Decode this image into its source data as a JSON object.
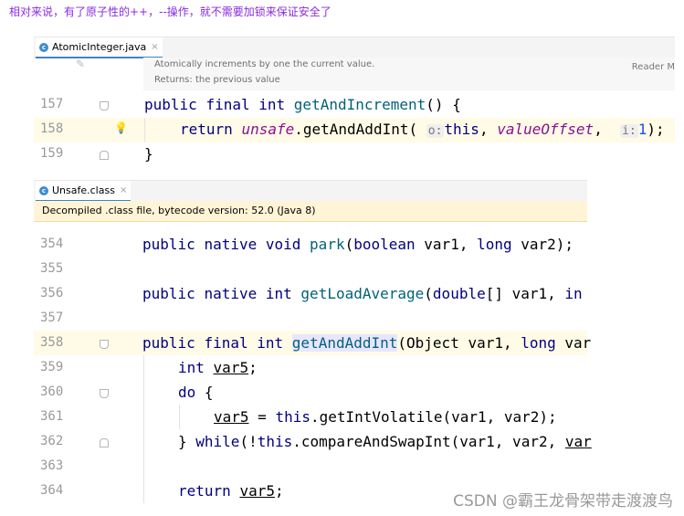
{
  "caption": "相对来说，有了原子性的++，--操作，就不需要加锁来保证安全了",
  "editor1": {
    "tab": {
      "label": "AtomicInteger.java",
      "icon": "java-class-icon",
      "close": "×"
    },
    "doc": {
      "line1": "Atomically increments by one the current value.",
      "line2": "Returns: the previous value",
      "reader": "Reader M"
    },
    "lines": [
      {
        "num": "157"
      },
      {
        "num": "158"
      },
      {
        "num": "159"
      }
    ],
    "code": {
      "l157": {
        "kw1": "public",
        "kw2": "final",
        "kw3": "int",
        "name": "getAndIncrement",
        "rest": "() {"
      },
      "l158": {
        "kw": "return",
        "field": "unsafe",
        "dot": ".",
        "method": "getAndAddInt(",
        "hint1": "o:",
        "this": "this",
        "comma1": ",",
        "field2": "valueOffset",
        "comma2": ",",
        "hint2": "i:",
        "num": "1",
        "end": ");"
      },
      "l159": {
        "brace": "}"
      }
    }
  },
  "editor2": {
    "tab": {
      "label": "Unsafe.class",
      "icon": "class-icon",
      "close": "×"
    },
    "notice": "Decompiled .class file, bytecode version: 52.0 (Java 8)",
    "lines": [
      "354",
      "355",
      "356",
      "357",
      "358",
      "359",
      "360",
      "361",
      "362",
      "363",
      "364"
    ],
    "code": {
      "l354": {
        "kw1": "public",
        "kw2": "native",
        "kw3": "void",
        "name": "park",
        "p1": "(",
        "t1": "boolean",
        "v1": " var1, ",
        "t2": "long",
        "v2": " var2);"
      },
      "l356": {
        "kw1": "public",
        "kw2": "native",
        "kw3": "int",
        "name": "getLoadAverage",
        "p1": "(",
        "t1": "double",
        "v1": "[] var1, ",
        "t2": "in"
      },
      "l358": {
        "kw1": "public",
        "kw2": "final",
        "kw3": "int",
        "name": "getAndAddInt",
        "p1": "(Object var1, ",
        "t2": "long",
        "v2": " var"
      },
      "l359": {
        "kw": "int",
        "var": "var5",
        "end": ";"
      },
      "l360": {
        "kw": "do",
        "end": " {"
      },
      "l361": {
        "var": "var5",
        "eq": " = ",
        "this": "this",
        "rest": ".getIntVolatile(var1, var2);"
      },
      "l362": {
        "brace": "} ",
        "kw": "while",
        "p": "(!",
        "this": "this",
        "rest": ".compareAndSwapInt(var1, var2, ",
        "var": "var"
      },
      "l364": {
        "kw": "return",
        "var": "var5",
        "end": ";"
      }
    }
  },
  "watermark": "CSDN @霸王龙骨架带走渡渡鸟",
  "colors": {
    "keyword": "#000080",
    "method": "#00627a",
    "field": "#871094",
    "number": "#1750eb",
    "caption": "#8a2be2"
  }
}
